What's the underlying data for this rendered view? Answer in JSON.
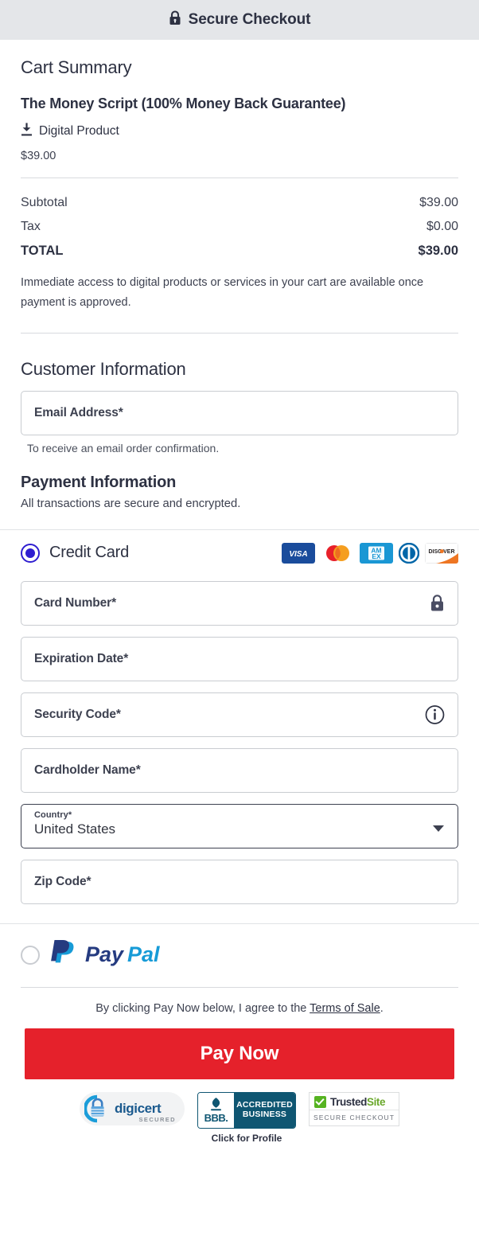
{
  "header": {
    "title": "Secure Checkout",
    "icon": "lock-icon",
    "bg_color": "#e4e6e9",
    "text_color": "#2d3142"
  },
  "cart": {
    "heading": "Cart Summary",
    "product_title": "The Money Script (100% Money Back Guarantee)",
    "product_type": "Digital Product",
    "product_type_icon": "download-icon",
    "product_price": "$39.00",
    "totals": [
      {
        "label": "Subtotal",
        "value": "$39.00",
        "emphasis": false
      },
      {
        "label": "Tax",
        "value": "$0.00",
        "emphasis": false
      },
      {
        "label": "TOTAL",
        "value": "$39.00",
        "emphasis": true
      }
    ],
    "note": "Immediate access to digital products or services in your cart are available once payment is approved."
  },
  "customer": {
    "heading": "Customer Information",
    "email_label": "Email Address*",
    "email_value": "",
    "email_helper": "To receive an email order confirmation."
  },
  "payment": {
    "heading": "Payment Information",
    "subtext": "All transactions are secure and encrypted.",
    "methods": [
      {
        "id": "credit-card",
        "label": "Credit Card",
        "selected": true
      },
      {
        "id": "paypal",
        "label": "PayPal",
        "selected": false
      }
    ],
    "accepted_cards": [
      "VISA",
      "Mastercard",
      "AMEX",
      "Diners Club",
      "Discover"
    ],
    "radio_accent": "#2f1ed0",
    "fields": [
      {
        "name": "card-number",
        "label": "Card Number*",
        "value": "",
        "icon": "lock-icon"
      },
      {
        "name": "expiration-date",
        "label": "Expiration Date*",
        "value": "",
        "icon": ""
      },
      {
        "name": "security-code",
        "label": "Security Code*",
        "value": "",
        "icon": "info-icon"
      },
      {
        "name": "cardholder-name",
        "label": "Cardholder Name*",
        "value": "",
        "icon": ""
      }
    ],
    "country": {
      "label": "Country*",
      "value": "United States",
      "icon": "chevron-down-icon"
    },
    "zip": {
      "label": "Zip Code*",
      "value": ""
    },
    "paypal_logo_text": {
      "first": "Pay",
      "second": "Pal"
    }
  },
  "footer": {
    "terms_prefix": "By clicking Pay Now below, I agree to the ",
    "terms_link": "Terms of Sale",
    "terms_suffix": ".",
    "pay_button": "Pay Now",
    "pay_button_color": "#e5212b",
    "badges": {
      "digicert": {
        "name": "digicert",
        "sub": "SECURED"
      },
      "bbb": {
        "word": "BBB.",
        "line1": "ACCREDITED",
        "line2": "BUSINESS",
        "cta": "Click for Profile"
      },
      "trustedsite": {
        "name_dark": "Trusted",
        "name_green": "Site",
        "sub": "SECURE CHECKOUT"
      }
    }
  }
}
